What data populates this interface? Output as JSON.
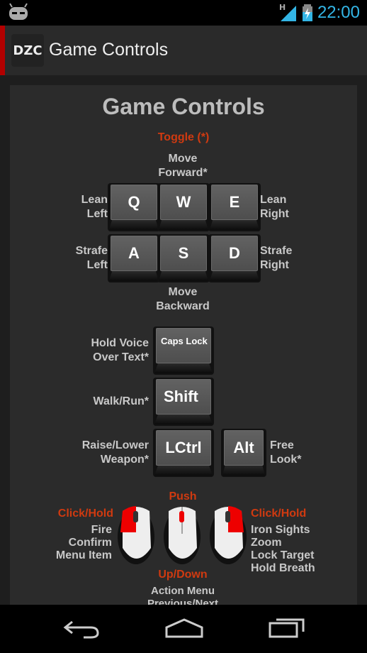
{
  "status": {
    "time": "22:00",
    "network": "H",
    "icons": [
      "cyanogen-mascot-icon",
      "signal-icon",
      "battery-charging-icon"
    ]
  },
  "actionbar": {
    "logo": "DZC",
    "title": "Game Controls"
  },
  "content": {
    "heading": "Game Controls",
    "toggle_note": "Toggle (*)",
    "keys": {
      "q": "Q",
      "w": "W",
      "e": "E",
      "a": "A",
      "s": "S",
      "d": "D",
      "caps": "Caps Lock",
      "shift": "Shift",
      "lctrl": "LCtrl",
      "alt": "Alt"
    },
    "labels": {
      "move_forward": [
        "Move",
        "Forward*"
      ],
      "lean_left": [
        "Lean",
        "Left"
      ],
      "lean_right": [
        "Lean",
        "Right"
      ],
      "strafe_left": [
        "Strafe",
        "Left"
      ],
      "strafe_right": [
        "Strafe",
        "Right"
      ],
      "move_backward": [
        "Move",
        "Backward"
      ],
      "voice": [
        "Hold Voice",
        "Over Text*"
      ],
      "walk": "Walk/Run*",
      "weapon": [
        "Raise/Lower",
        "Weapon*"
      ],
      "free_look": [
        "Free",
        "Look*"
      ]
    },
    "mouse": {
      "left_title": "Click/Hold",
      "left_actions": [
        "Fire",
        "Confirm",
        "Menu Item"
      ],
      "wheel_push": "Push",
      "wheel_scroll": "Up/Down",
      "wheel_actions": [
        "Action Menu",
        "Previous/Next"
      ],
      "right_title": "Click/Hold",
      "right_actions": [
        "Iron Sights",
        "Zoom",
        "Lock Target",
        "Hold Breath"
      ]
    }
  },
  "colors": {
    "accent_red": "#d03a10",
    "clock_blue": "#33b5e5",
    "actionbar_marker": "#b30000"
  },
  "navbar": {
    "icons": [
      "back-icon",
      "home-icon",
      "recent-apps-icon"
    ]
  }
}
